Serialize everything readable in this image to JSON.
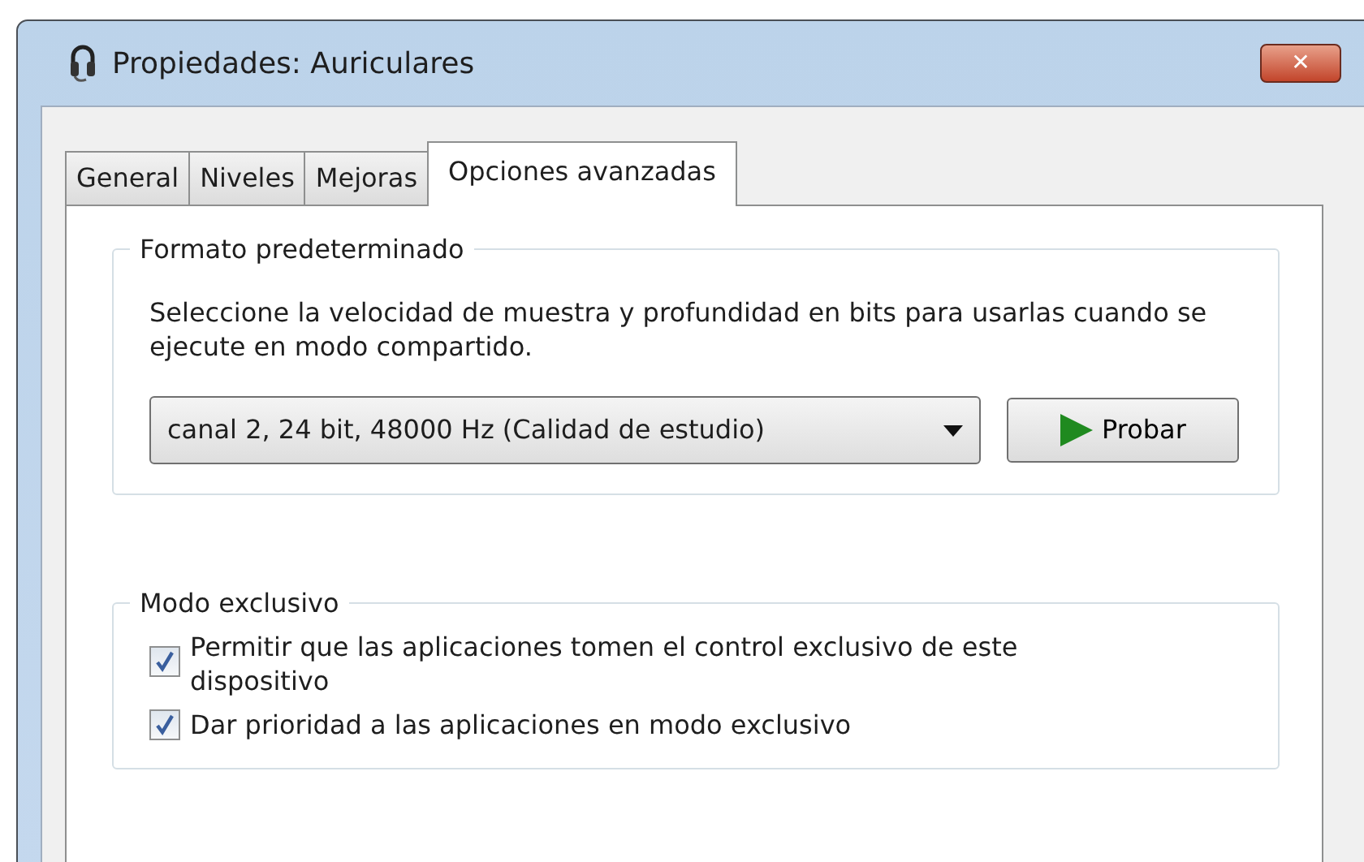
{
  "window": {
    "title": "Propiedades: Auriculares",
    "close": "✕"
  },
  "tabs": [
    {
      "label": "General",
      "selected": false
    },
    {
      "label": "Niveles",
      "selected": false
    },
    {
      "label": "Mejoras",
      "selected": false
    },
    {
      "label": "Opciones avanzadas",
      "selected": true
    }
  ],
  "default_format": {
    "title": "Formato predeterminado",
    "description": "Seleccione la velocidad de muestra y profundidad en bits para usarlas cuando se ejecute en modo compartido.",
    "value": "canal 2, 24 bit, 48000 Hz (Calidad de estudio)",
    "test_button": "Probar"
  },
  "exclusive_mode": {
    "title": "Modo exclusivo",
    "options": [
      {
        "label": "Permitir que las aplicaciones tomen el control exclusivo de este dispositivo",
        "checked": true
      },
      {
        "label": "Dar prioridad a las aplicaciones en modo exclusivo",
        "checked": true
      }
    ]
  }
}
